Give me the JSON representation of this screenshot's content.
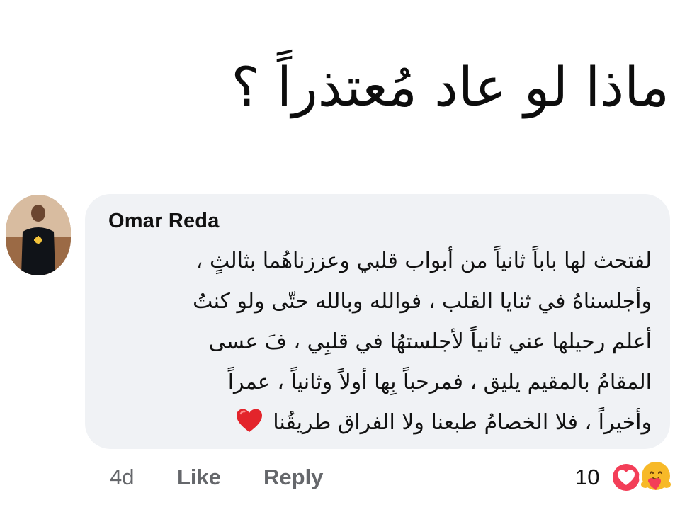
{
  "headline": "ماذا لو عاد مُعتذراً ؟",
  "comment": {
    "author": "Omar Reda",
    "lines": [
      "لفتحث لها باباً ثانياً من أبواب قلبي وعززناهُما بثالثٍ ،",
      "وأجلسناهُ في ثنايا القلب ، فوالله وبالله حتّى ولو كنتُ",
      "أعلم رحيلها عني ثانياً لأجلستهُا في قلبِي ، فَ عسى",
      "المقامُ بالمقيم يليق ، فمرحباً بِها أولاً وثانياً ، عمراً",
      "وأخيراً ، فلا الخصامُ طبعنا ولا الفراق طريقُنا"
    ],
    "trailing_emoji": "red-heart-icon",
    "time": "4d",
    "like_label": "Like",
    "reply_label": "Reply",
    "reaction_count": "10",
    "reaction_icons": [
      "love-reaction-icon",
      "care-reaction-icon"
    ]
  },
  "colors": {
    "bubble": "#f0f2f5",
    "meta_text": "#65676b",
    "love_red": "#f33e58",
    "care_yellow": "#f7b928"
  }
}
